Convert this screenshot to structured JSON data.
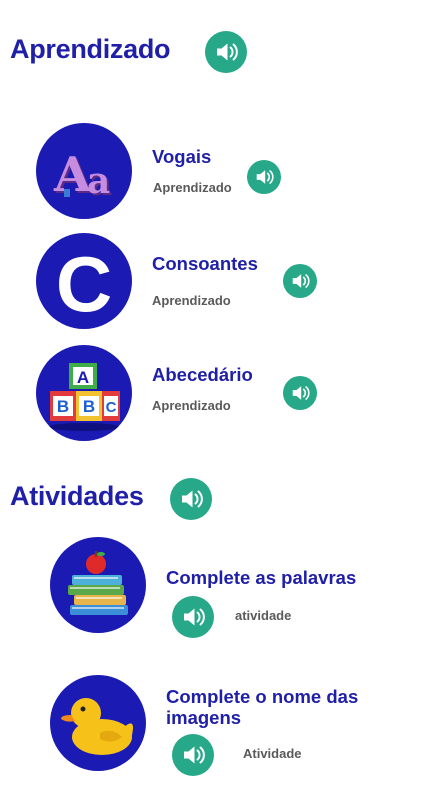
{
  "sections": [
    {
      "title": "Aprendizado",
      "items": [
        {
          "title": "Vogais",
          "subtitle": "Aprendizado",
          "icon": "letters-aa-icon"
        },
        {
          "title": "Consoantes",
          "subtitle": "Aprendizado",
          "icon": "letter-c-icon"
        },
        {
          "title": "Abecedário",
          "subtitle": "Aprendizado",
          "icon": "abc-blocks-icon"
        }
      ]
    },
    {
      "title": "Atividades",
      "items": [
        {
          "title": "Complete as palavras",
          "subtitle": "atividade",
          "icon": "books-apple-icon"
        },
        {
          "title": "Complete o nome das imagens",
          "subtitle": "Atividade",
          "icon": "rubber-duck-icon"
        }
      ]
    }
  ],
  "thumb_letters": {
    "vogais": "Aa",
    "consoantes": "C",
    "block_a": "A",
    "block_b": "B",
    "block_c": "C"
  },
  "colors": {
    "title": "#1f1fa8",
    "speaker": "#26a889",
    "thumb_bg": "#1b1bb4",
    "subtitle": "#5a5a5a"
  },
  "speaker_icon": "speaker-icon"
}
